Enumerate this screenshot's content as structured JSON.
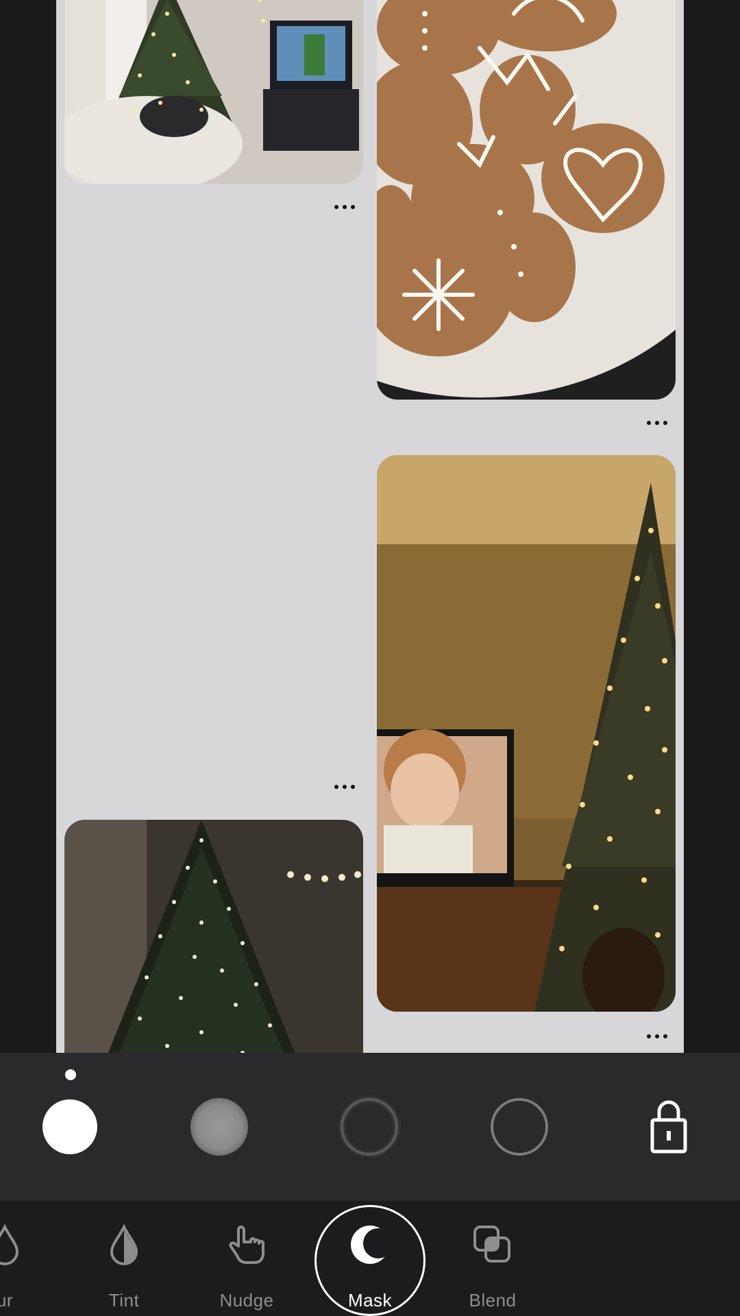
{
  "canvas": {
    "pins": [
      {
        "name": "pin-christmas-living-room",
        "more_label": "•••"
      },
      {
        "name": "pin-gingerbread-cookies",
        "more_label": "•••"
      },
      {
        "name": "pin-empty-slot",
        "more_label": "•••"
      },
      {
        "name": "pin-tree-home-alone",
        "more_label": "•••"
      },
      {
        "name": "pin-lit-tree",
        "more_label": "•••"
      }
    ]
  },
  "brush_panel": {
    "brushes": [
      {
        "name": "hard-brush",
        "selected": true
      },
      {
        "name": "soft-brush",
        "selected": false
      },
      {
        "name": "soft-ring-brush",
        "selected": false
      },
      {
        "name": "ring-brush",
        "selected": false
      }
    ],
    "lock_icon": "lock-icon"
  },
  "toolbar": {
    "tools": [
      {
        "label": "ur",
        "icon": "blur-drop-icon",
        "active": false
      },
      {
        "label": "Tint",
        "icon": "tint-drop-icon",
        "active": false
      },
      {
        "label": "Nudge",
        "icon": "hand-pointer-icon",
        "active": false
      },
      {
        "label": "Mask",
        "icon": "moon-mask-icon",
        "active": true
      },
      {
        "label": "Blend",
        "icon": "blend-squares-icon",
        "active": false
      }
    ]
  },
  "colors": {
    "background": "#1a1a1c",
    "canvas": "#d7d7d9",
    "panel": "#2a2a2c",
    "toolbar": "#1c1c1e",
    "active": "#ffffff",
    "inactive": "#8e8e90"
  }
}
